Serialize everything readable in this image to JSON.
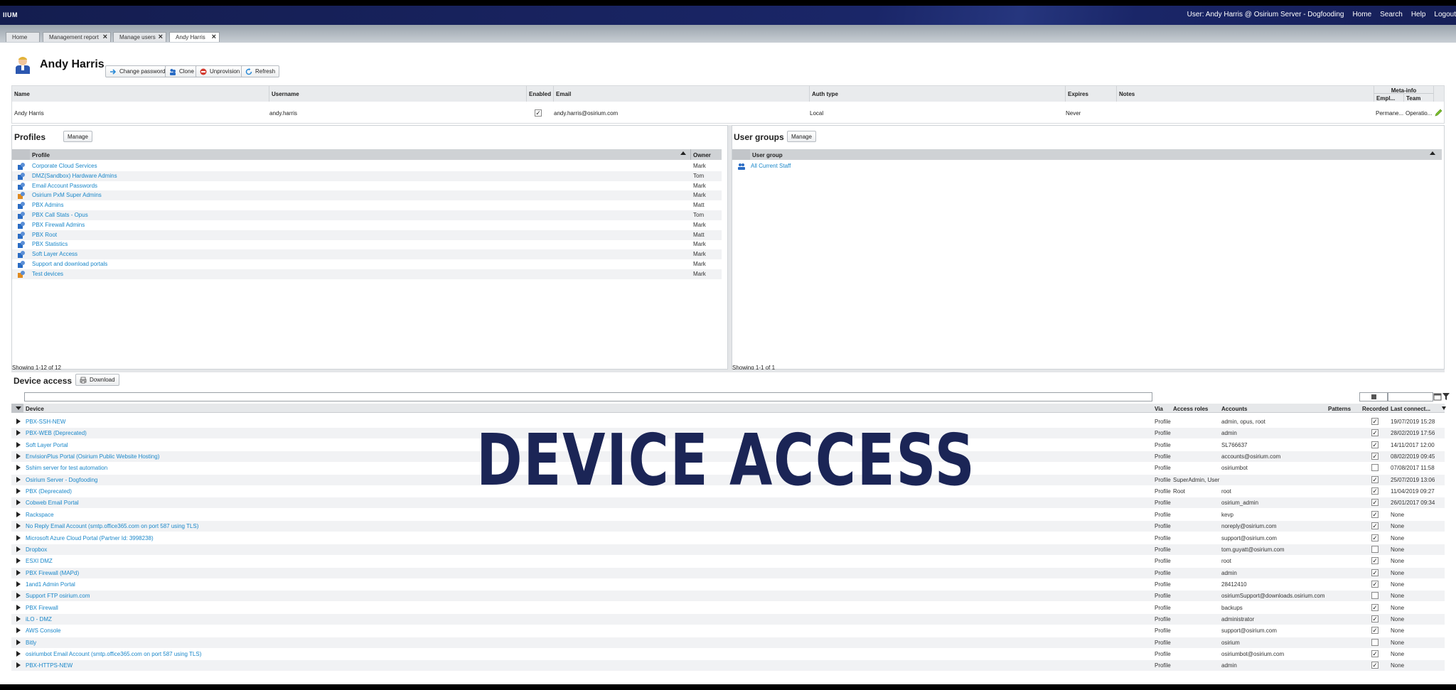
{
  "app": {
    "brand": "IIUM",
    "nav": [
      "User: Andy Harris @ Osirium Server - Dogfooding",
      "Home",
      "Search",
      "Help",
      "Logout"
    ]
  },
  "tabs": [
    {
      "label": "Home",
      "closable": false,
      "active": false
    },
    {
      "label": "Management report",
      "closable": true,
      "active": false
    },
    {
      "label": "Manage users",
      "closable": true,
      "active": false
    },
    {
      "label": "Andy Harris",
      "closable": true,
      "active": true
    }
  ],
  "user": {
    "name": "Andy Harris",
    "actions": [
      "Change password",
      "Clone",
      "Unprovision",
      "Refresh"
    ],
    "columns": [
      "Name",
      "Username",
      "Enabled",
      "Email",
      "Auth type",
      "Expires",
      "Notes"
    ],
    "meta_group": "Meta-info",
    "meta_columns": [
      "Empl...",
      "Team"
    ],
    "row": {
      "name": "Andy Harris",
      "username": "andy.harris",
      "enabled": "✓",
      "email": "andy.harris@osirium.com",
      "auth_type": "Local",
      "expires": "Never",
      "notes": "",
      "employment": "Permane...",
      "team": "Operatio..."
    }
  },
  "profiles": {
    "title": "Profiles",
    "manage_label": "Manage",
    "col_profile": "Profile",
    "col_owner": "Owner",
    "footer": "Showing 1-12 of 12",
    "items": [
      {
        "name": "Corporate Cloud Services",
        "owner": "Mark",
        "kind": "user"
      },
      {
        "name": "DMZ(Sandbox) Hardware Admins",
        "owner": "Tom",
        "kind": "user"
      },
      {
        "name": "Email Account Passwords",
        "owner": "Mark",
        "kind": "user"
      },
      {
        "name": "Osirium PxM Super Admins",
        "owner": "Mark",
        "kind": "admin"
      },
      {
        "name": "PBX Admins",
        "owner": "Matt",
        "kind": "user"
      },
      {
        "name": "PBX Call Stats - Opus",
        "owner": "Tom",
        "kind": "user"
      },
      {
        "name": "PBX Firewall Admins",
        "owner": "Mark",
        "kind": "user"
      },
      {
        "name": "PBX Root",
        "owner": "Matt",
        "kind": "user"
      },
      {
        "name": "PBX Statistics",
        "owner": "Mark",
        "kind": "user"
      },
      {
        "name": "Soft Layer Access",
        "owner": "Mark",
        "kind": "user"
      },
      {
        "name": "Support and download portals",
        "owner": "Mark",
        "kind": "user"
      },
      {
        "name": "Test devices",
        "owner": "Mark",
        "kind": "admin"
      }
    ]
  },
  "user_groups": {
    "title": "User groups",
    "manage_label": "Manage",
    "col_group": "User group",
    "footer": "Showing 1-1 of 1",
    "items": [
      {
        "name": "All Current Staff"
      }
    ]
  },
  "device_access": {
    "title": "Device access",
    "download_label": "Download",
    "columns": [
      "Device",
      "Via",
      "Access roles",
      "Accounts",
      "Patterns",
      "Recorded",
      "Last connect..."
    ],
    "banner": "DEVICE ACCESS",
    "rows": [
      {
        "device": "PBX-SSH-NEW",
        "via": "Profile",
        "roles": "",
        "accounts": "admin, opus, root",
        "recorded": true,
        "last": "19/07/2019 15:28"
      },
      {
        "device": "PBX-WEB (Deprecated)",
        "via": "Profile",
        "roles": "",
        "accounts": "admin",
        "recorded": true,
        "last": "28/02/2019 17:56"
      },
      {
        "device": "Soft Layer Portal",
        "via": "Profile",
        "roles": "",
        "accounts": "SL766637",
        "recorded": true,
        "last": "14/11/2017 12:00"
      },
      {
        "device": "EnvisionPlus Portal (Osirium Public Website Hosting)",
        "via": "Profile",
        "roles": "",
        "accounts": "accounts@osirium.com",
        "recorded": true,
        "last": "08/02/2019 09:45"
      },
      {
        "device": "Sshim server for test automation",
        "via": "Profile",
        "roles": "",
        "accounts": "osiriumbot",
        "recorded": false,
        "last": "07/08/2017 11:58"
      },
      {
        "device": "Osirium Server - Dogfooding",
        "via": "Profile",
        "roles": "SuperAdmin, User",
        "accounts": "",
        "recorded": true,
        "last": "25/07/2019 13:06"
      },
      {
        "device": "PBX (Deprecated)",
        "via": "Profile",
        "roles": "Root",
        "accounts": "root",
        "recorded": true,
        "last": "11/04/2019 09:27"
      },
      {
        "device": "Cobweb Email Portal",
        "via": "Profile",
        "roles": "",
        "accounts": "osirium_admin",
        "recorded": true,
        "last": "26/01/2017 09:34"
      },
      {
        "device": "Rackspace",
        "via": "Profile",
        "roles": "",
        "accounts": "kevp",
        "recorded": true,
        "last": "None"
      },
      {
        "device": "No Reply Email Account (smtp.office365.com on port 587 using TLS)",
        "via": "Profile",
        "roles": "",
        "accounts": "noreply@osirium.com",
        "recorded": true,
        "last": "None"
      },
      {
        "device": "Microsoft Azure Cloud Portal (Partner Id: 3998238)",
        "via": "Profile",
        "roles": "",
        "accounts": "support@osirium.com",
        "recorded": true,
        "last": "None"
      },
      {
        "device": "Dropbox",
        "via": "Profile",
        "roles": "",
        "accounts": "tom.guyatt@osirium.com",
        "recorded": false,
        "last": "None"
      },
      {
        "device": "ESXI DMZ",
        "via": "Profile",
        "roles": "",
        "accounts": "root",
        "recorded": true,
        "last": "None"
      },
      {
        "device": "PBX Firewall (MAPd)",
        "via": "Profile",
        "roles": "",
        "accounts": "admin",
        "recorded": true,
        "last": "None"
      },
      {
        "device": "1and1 Admin Portal",
        "via": "Profile",
        "roles": "",
        "accounts": "28412410",
        "recorded": true,
        "last": "None"
      },
      {
        "device": "Support FTP osirium.com",
        "via": "Profile",
        "roles": "",
        "accounts": "osiriumSupport@downloads.osirium.com",
        "recorded": false,
        "last": "None"
      },
      {
        "device": "PBX Firewall",
        "via": "Profile",
        "roles": "",
        "accounts": "backups",
        "recorded": true,
        "last": "None"
      },
      {
        "device": "iLO - DMZ",
        "via": "Profile",
        "roles": "",
        "accounts": "administrator",
        "recorded": true,
        "last": "None"
      },
      {
        "device": "AWS Console",
        "via": "Profile",
        "roles": "",
        "accounts": "support@osirium.com",
        "recorded": true,
        "last": "None"
      },
      {
        "device": "Bitly",
        "via": "Profile",
        "roles": "",
        "accounts": "osirium",
        "recorded": false,
        "last": "None"
      },
      {
        "device": "osiriumbot Email Account (smtp.office365.com on port 587 using TLS)",
        "via": "Profile",
        "roles": "",
        "accounts": "osiriumbot@osirium.com",
        "recorded": true,
        "last": "None"
      },
      {
        "device": "PBX-HTTPS-NEW",
        "via": "Profile",
        "roles": "",
        "accounts": "admin",
        "recorded": true,
        "last": "None"
      }
    ]
  },
  "colors": {
    "link": "#1a87c9",
    "topbar": "#1a2668",
    "banner": "#1b2556"
  }
}
